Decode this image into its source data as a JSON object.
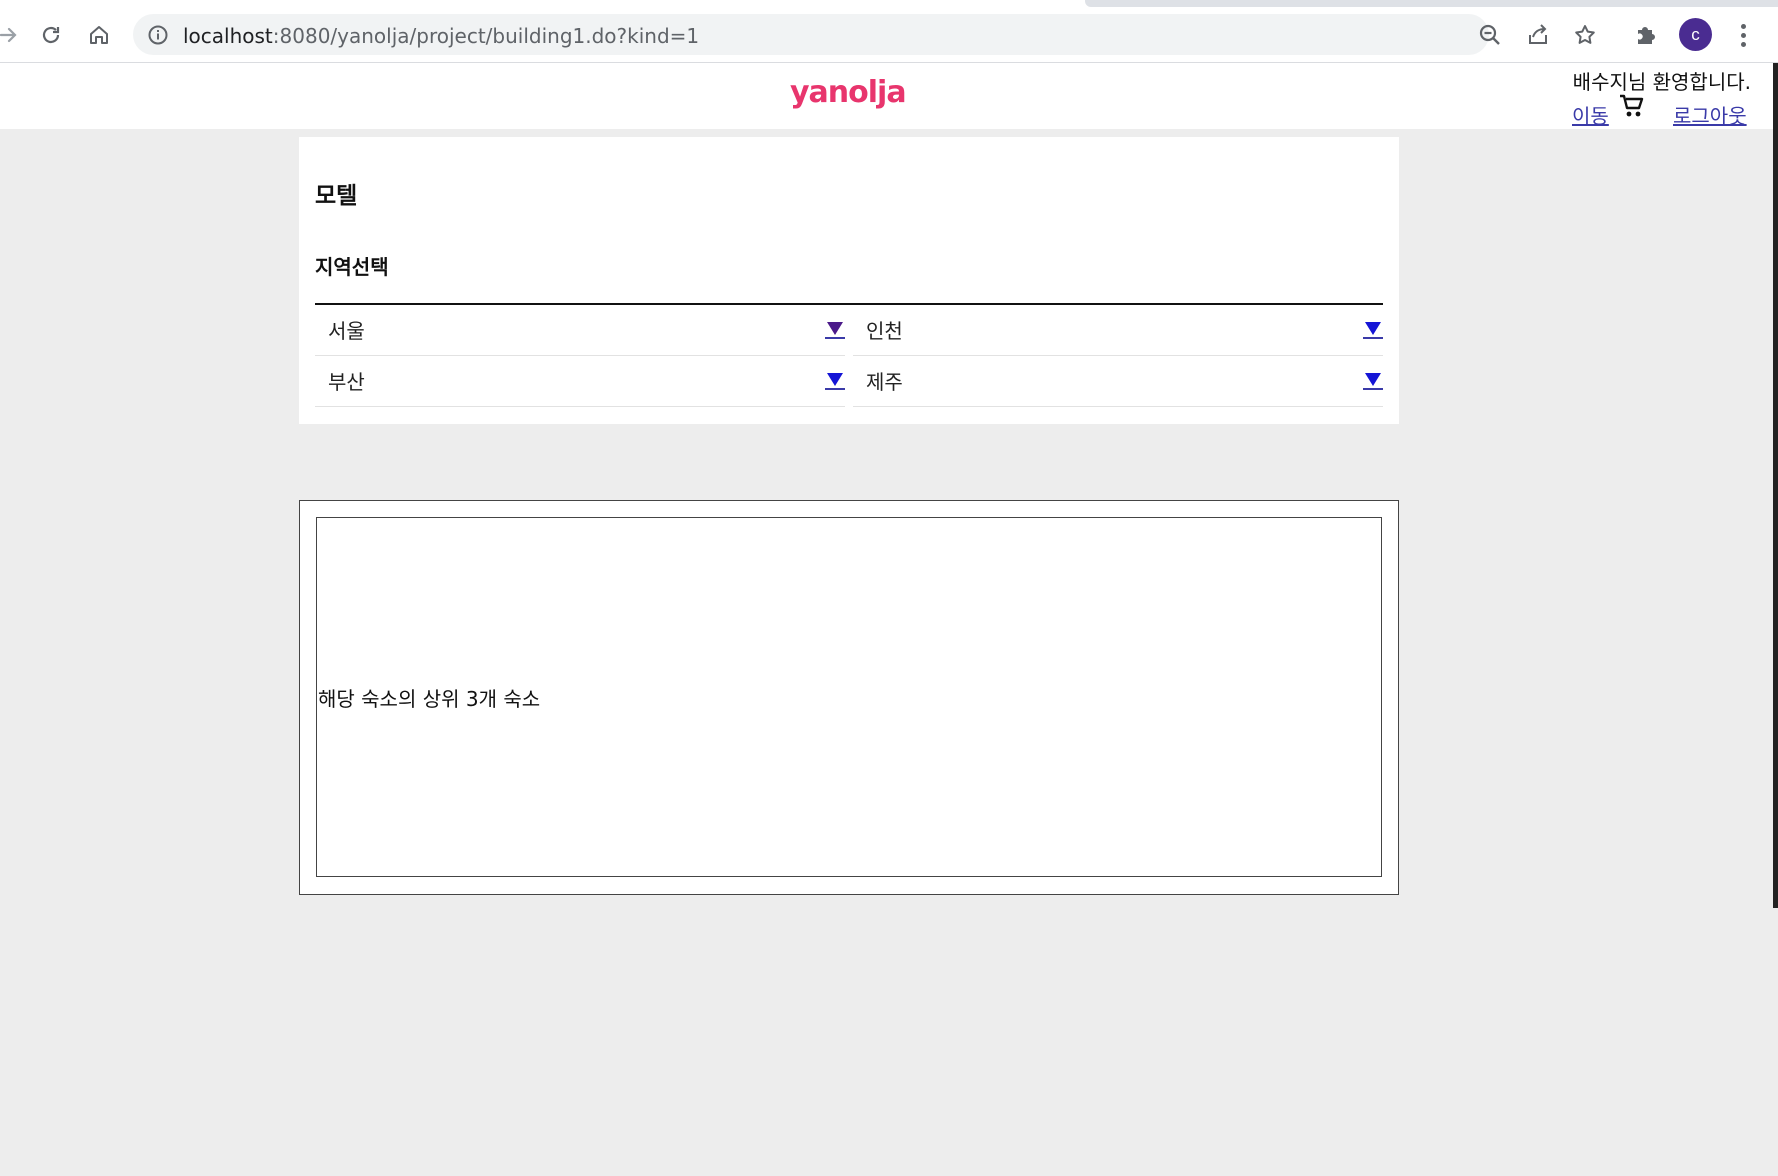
{
  "browser": {
    "url_host": "localhost",
    "url_rest": ":8080/yanolja/project/building1.do?kind=1",
    "profile_initial": "c",
    "icons": [
      "forward-icon",
      "reload-icon",
      "home-icon",
      "info-icon",
      "zoom-out-icon",
      "share-icon",
      "bookmark-star-icon",
      "extensions-icon",
      "menu-kebab-icon"
    ]
  },
  "header": {
    "logo": "yanolja",
    "welcome": "배수지님 환영합니다.",
    "move_link": "이동",
    "logout_link": "로그아웃",
    "cart_icon": "cart-icon"
  },
  "panel": {
    "title": "모텔",
    "subtitle": "지역선택",
    "regions": [
      {
        "label": "서울"
      },
      {
        "label": "인천"
      },
      {
        "label": "부산"
      },
      {
        "label": "제주"
      }
    ]
  },
  "results": {
    "text": "해당 숙소의 상위 3개 숙소"
  },
  "colors": {
    "brand": "#e8356d",
    "link": "#3a3aa8",
    "page_bg": "#ededed",
    "avatar": "#4a2c91"
  }
}
